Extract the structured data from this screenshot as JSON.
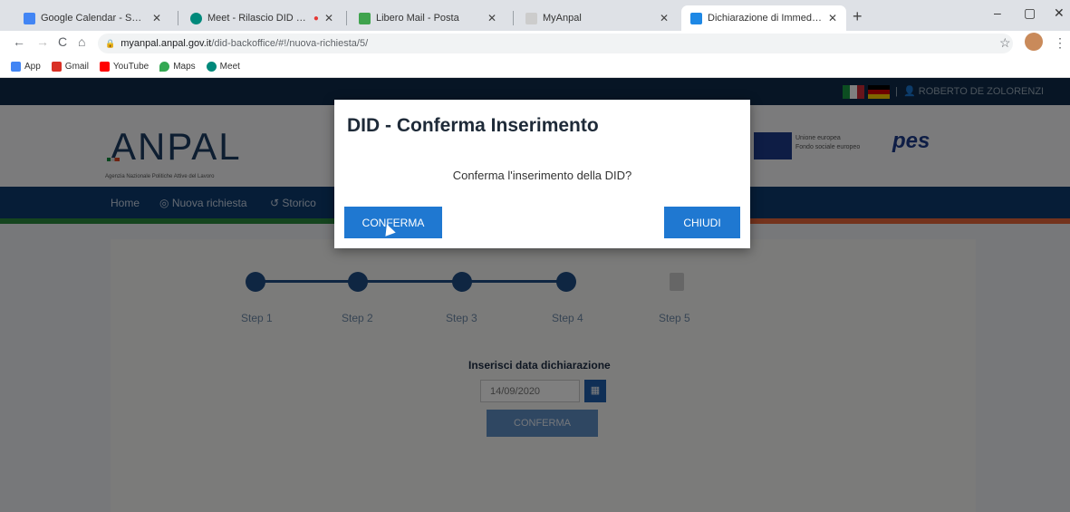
{
  "tabs": [
    {
      "title": "Google Calendar - Settimana del",
      "color": "#4285f4",
      "active": false
    },
    {
      "title": "Meet - Rilascio DID on line",
      "color": "#00897b",
      "active": false,
      "recording": true
    },
    {
      "title": "Libero Mail - Posta",
      "color": "#3fa34d",
      "active": false
    },
    {
      "title": "MyAnpal",
      "color": "#cccccc",
      "active": false
    },
    {
      "title": "Dichiarazione di Immediata Disp",
      "color": "#1e88e5",
      "active": true
    }
  ],
  "address": {
    "host": "myanpal.anpal.gov.it",
    "path": "/did-backoffice/#!/nuova-richiesta/5/"
  },
  "bookmarks": [
    {
      "label": "App",
      "color": "#4285f4"
    },
    {
      "label": "Gmail",
      "color": "#d93025"
    },
    {
      "label": "YouTube",
      "color": "#ff0000"
    },
    {
      "label": "Maps",
      "color": "#34a853"
    },
    {
      "label": "Meet",
      "color": "#00897b"
    }
  ],
  "site": {
    "user": "ROBERTO DE ZOLORENZI",
    "logo": "ANPAL",
    "logo_subtitle": "Agenzia Nazionale Politiche Attive del Lavoro",
    "eu_text": [
      "Unione europea",
      "Fondo sociale europeo"
    ],
    "pes": "pes",
    "nav": [
      "Home",
      "Nuova richiesta",
      "Storico"
    ]
  },
  "steps": [
    "Step 1",
    "Step 2",
    "Step 3",
    "Step 4",
    "Step 5"
  ],
  "form": {
    "title": "Inserisci data dichiarazione",
    "date_value": "14/09/2020",
    "submit_label": "CONFERMA"
  },
  "modal": {
    "title": "DID - Conferma Inserimento",
    "message": "Conferma l'inserimento della DID?",
    "confirm_label": "CONFERMA",
    "close_label": "CHIUDI"
  }
}
